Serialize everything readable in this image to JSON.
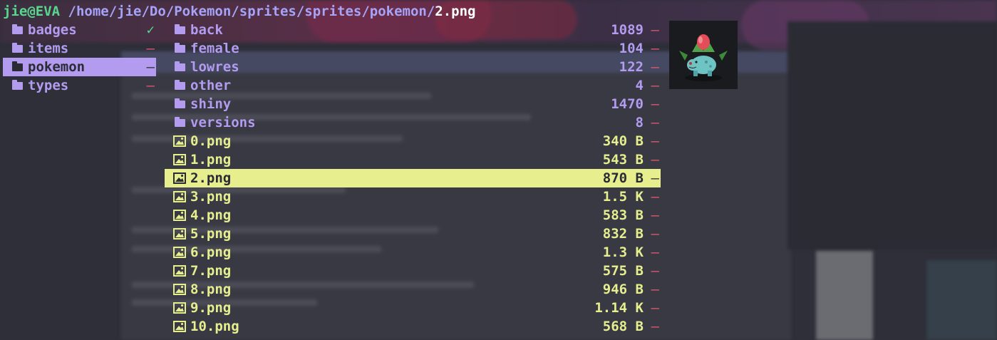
{
  "title": {
    "user": "jie@EVA",
    "path": "/home/jie/Do/Pokemon/sprites/sprites/pokemon/",
    "file": "2.png"
  },
  "parent_dir": [
    {
      "name": "badges",
      "flag": "✓"
    },
    {
      "name": "items",
      "flag": "–"
    },
    {
      "name": "pokemon",
      "flag": "–",
      "selected": true
    },
    {
      "name": "types",
      "flag": "–"
    }
  ],
  "current_dir": [
    {
      "name": "back",
      "size": "1089",
      "flag": "–",
      "type": "dir"
    },
    {
      "name": "female",
      "size": "104",
      "flag": "–",
      "type": "dir"
    },
    {
      "name": "lowres",
      "size": "122",
      "flag": "–",
      "type": "dir"
    },
    {
      "name": "other",
      "size": "4",
      "flag": "–",
      "type": "dir"
    },
    {
      "name": "shiny",
      "size": "1470",
      "flag": "–",
      "type": "dir"
    },
    {
      "name": "versions",
      "size": "8",
      "flag": "–",
      "type": "dir"
    },
    {
      "name": "0.png",
      "size": "340 B",
      "flag": "–",
      "type": "file"
    },
    {
      "name": "1.png",
      "size": "543 B",
      "flag": "–",
      "type": "file"
    },
    {
      "name": "2.png",
      "size": "870 B",
      "flag": "–",
      "type": "file",
      "selected": true
    },
    {
      "name": "3.png",
      "size": "1.5 K",
      "flag": "–",
      "type": "file"
    },
    {
      "name": "4.png",
      "size": "583 B",
      "flag": "–",
      "type": "file"
    },
    {
      "name": "5.png",
      "size": "832 B",
      "flag": "–",
      "type": "file"
    },
    {
      "name": "6.png",
      "size": "1.3 K",
      "flag": "–",
      "type": "file"
    },
    {
      "name": "7.png",
      "size": "575 B",
      "flag": "–",
      "type": "file"
    },
    {
      "name": "8.png",
      "size": "946 B",
      "flag": "–",
      "type": "file"
    },
    {
      "name": "9.png",
      "size": "1.14 K",
      "flag": "–",
      "type": "file"
    },
    {
      "name": "10.png",
      "size": "568 B",
      "flag": "–",
      "type": "file"
    }
  ],
  "preview": {
    "icon": "ivysaur-sprite"
  },
  "colors": {
    "directory": "#b39cf0",
    "image_file": "#e6ee8e",
    "user_host": "#58d68d",
    "path": "#a6a3f8",
    "flag_unmarked": "#e05a72",
    "flag_marked": "#58d68d"
  }
}
